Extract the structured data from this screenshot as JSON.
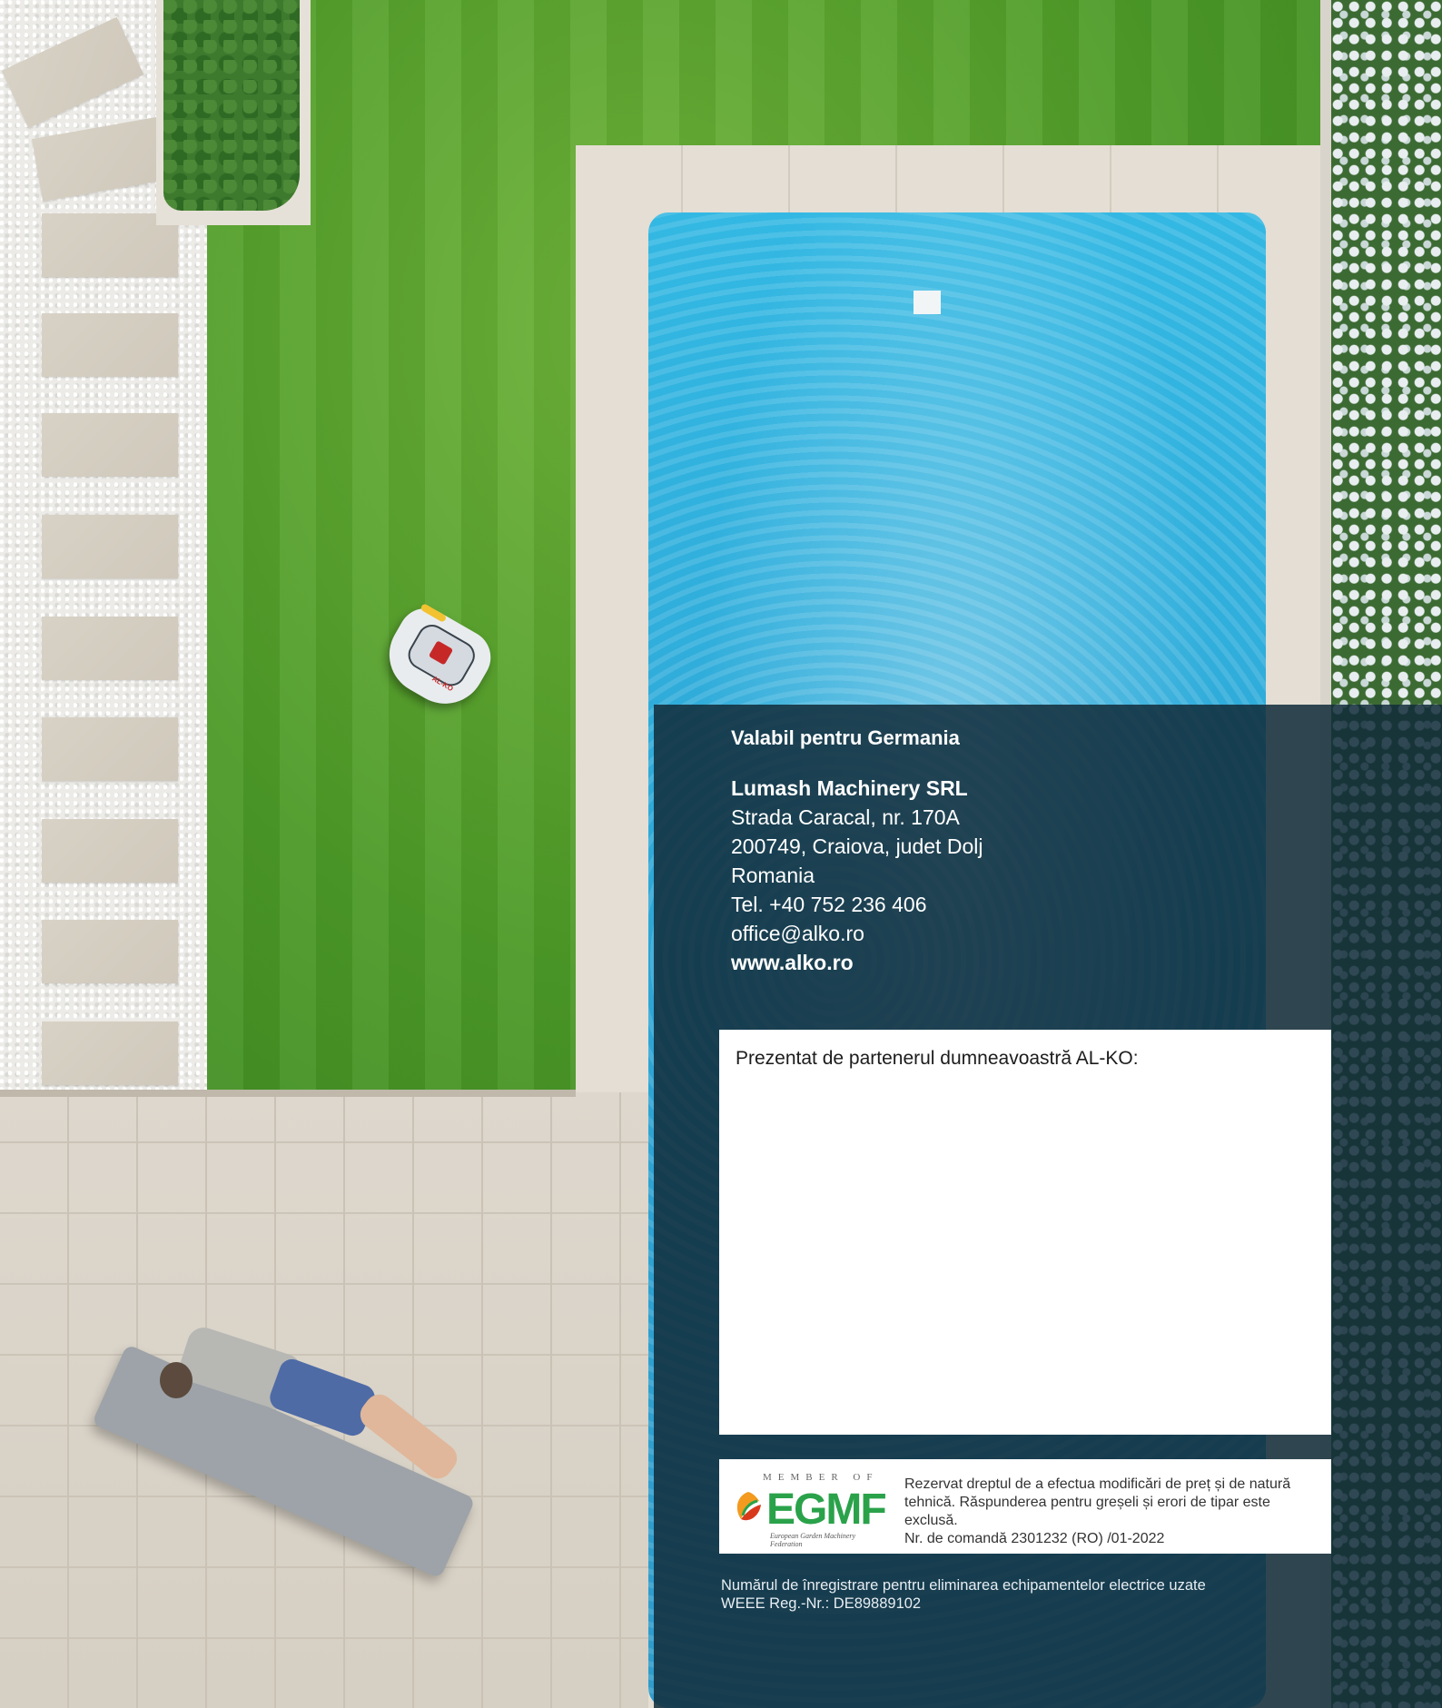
{
  "contact": {
    "validity": "Valabil pentru Germania",
    "company": "Lumash Machinery SRL",
    "street": "Strada Caracal, nr. 170A",
    "city": "200749, Craiova, judet Dolj",
    "country": "Romania",
    "phone": "Tel. +40 752 236 406",
    "email": "office@alko.ro",
    "website": "www.alko.ro"
  },
  "partner": {
    "label": "Prezentat de partenerul dumneavoastră AL-KO:"
  },
  "egmf": {
    "member_of": "MEMBER OF",
    "logo_text": "EGMF",
    "logo_subtitle": "European Garden Machinery Federation",
    "disclaimer_line1": "Rezervat dreptul de a efectua modificări de preț și de natură",
    "disclaimer_line2": "tehnică. Răspunderea pentru greșeli și erori de tipar este exclusă.",
    "order_number": "Nr. de comandă 2301232 (RO) /01-2022"
  },
  "weee": {
    "line1": "Numărul de înregistrare pentru eliminarea echipamentelor electrice uzate",
    "line2": "WEEE Reg.-Nr.: DE89889102"
  },
  "mower_brand": "AL-KO",
  "colors": {
    "overlay": "#122c3a",
    "egmf_green": "#2aa24a",
    "pool_blue": "#2ea6d6",
    "lawn_green": "#4c9a27"
  }
}
